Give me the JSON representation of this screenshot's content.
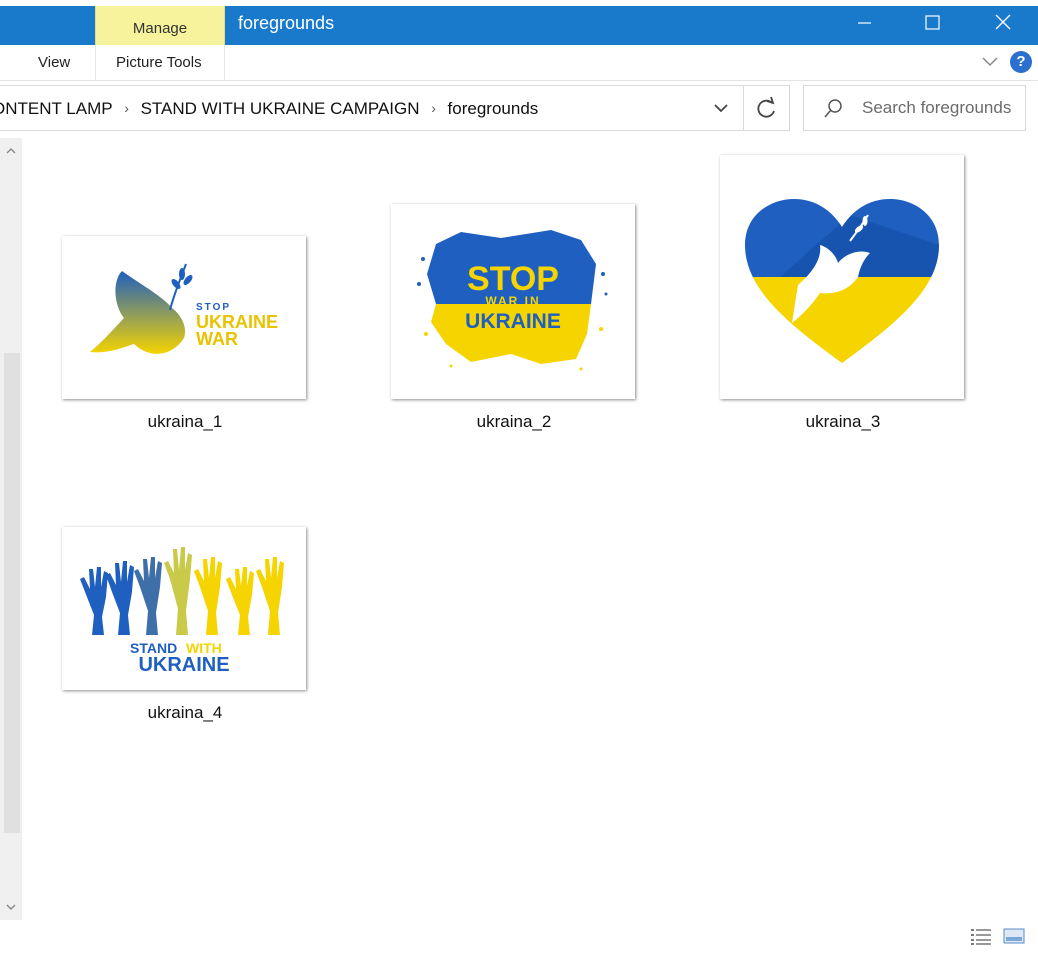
{
  "window": {
    "title": "foregrounds",
    "contextual_tab": "Manage",
    "colors": {
      "titlebar": "#1979ca",
      "manage_tab": "#f6f39c",
      "help": "#2b6fcf"
    }
  },
  "ribbon": {
    "tabs": [
      {
        "label": "View"
      },
      {
        "label": "Picture Tools"
      }
    ]
  },
  "address": {
    "breadcrumbs": [
      "ONTENT LAMP",
      "STAND WITH UKRAINE CAMPAIGN",
      "foregrounds"
    ],
    "separator": "›"
  },
  "search": {
    "placeholder": "Search foregrounds"
  },
  "files": [
    {
      "name": "ukraina_1",
      "thumb_text": [
        "STOP",
        "UKRAINE",
        "WAR"
      ]
    },
    {
      "name": "ukraina_2",
      "thumb_text": [
        "STOP",
        "WAR IN",
        "UKRAINE"
      ]
    },
    {
      "name": "ukraina_3",
      "thumb_text": []
    },
    {
      "name": "ukraina_4",
      "thumb_text": [
        "STAND",
        "WITH",
        "UKRAINE"
      ]
    }
  ],
  "brand_colors": {
    "blue": "#1f5fbf",
    "yellow": "#f5d400"
  }
}
